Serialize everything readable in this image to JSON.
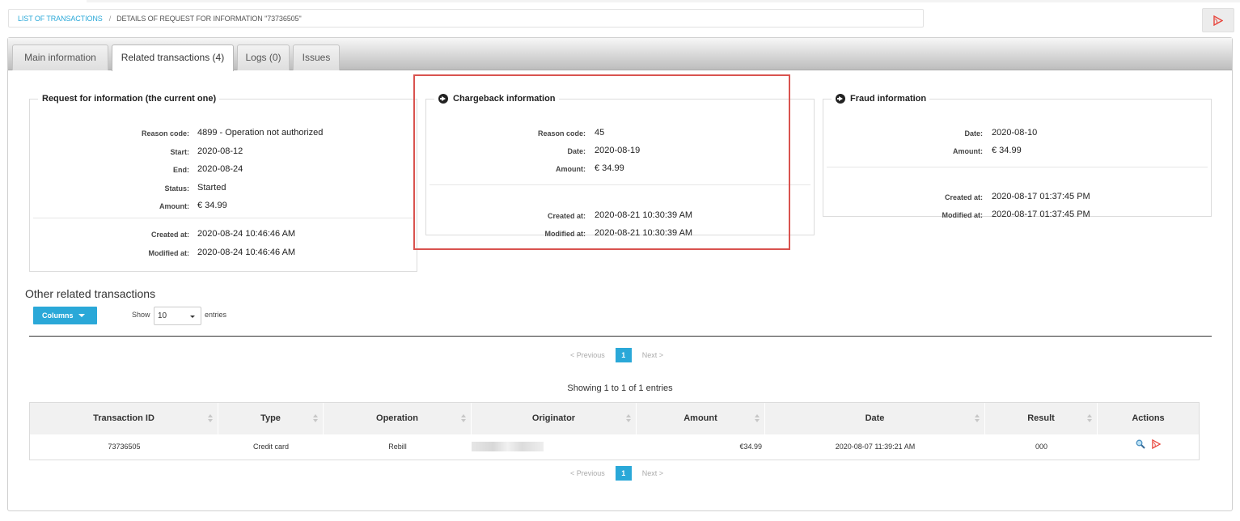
{
  "breadcrumb": {
    "link": "LIST OF TRANSACTIONS",
    "separator": "/",
    "current": "DETAILS OF REQUEST FOR INFORMATION \"73736505\""
  },
  "tabs": [
    {
      "label": "Main information",
      "active": false
    },
    {
      "label": "Related transactions (4)",
      "active": true
    },
    {
      "label": "Logs (0)",
      "active": false
    },
    {
      "label": "Issues",
      "active": false
    }
  ],
  "rfi": {
    "title": "Request for information (the current one)",
    "rows": [
      {
        "label": "Reason code:",
        "value": "4899 - Operation not authorized"
      },
      {
        "label": "Start:",
        "value": "2020-08-12"
      },
      {
        "label": "End:",
        "value": "2020-08-24"
      },
      {
        "label": "Status:",
        "value": "Started"
      },
      {
        "label": "Amount:",
        "value": "€ 34.99"
      }
    ],
    "meta": [
      {
        "label": "Created at:",
        "value": "2020-08-24 10:46:46 AM"
      },
      {
        "label": "Modified at:",
        "value": "2020-08-24 10:46:46 AM"
      }
    ]
  },
  "chargeback": {
    "title": "Chargeback information",
    "rows": [
      {
        "label": "Reason code:",
        "value": "45"
      },
      {
        "label": "Date:",
        "value": "2020-08-19"
      },
      {
        "label": "Amount:",
        "value": "€ 34.99"
      }
    ],
    "meta": [
      {
        "label": "Created at:",
        "value": "2020-08-21 10:30:39 AM"
      },
      {
        "label": "Modified at:",
        "value": "2020-08-21 10:30:39 AM"
      }
    ]
  },
  "fraud": {
    "title": "Fraud information",
    "rows": [
      {
        "label": "Date:",
        "value": "2020-08-10"
      },
      {
        "label": "Amount:",
        "value": "€ 34.99"
      }
    ],
    "meta": [
      {
        "label": "Created at:",
        "value": "2020-08-17 01:37:45 PM"
      },
      {
        "label": "Modified at:",
        "value": "2020-08-17 01:37:45 PM"
      }
    ]
  },
  "related": {
    "title": "Other related transactions",
    "columns_button": "Columns",
    "show_label": "Show",
    "entries_value": "10",
    "entries_label": "entries",
    "pager": {
      "prev": "< Previous",
      "page": "1",
      "next": "Next >"
    },
    "showing": "Showing 1 to 1 of 1 entries",
    "headers": [
      "Transaction ID",
      "Type",
      "Operation",
      "Originator",
      "Amount",
      "Date",
      "Result",
      "Actions"
    ],
    "rows": [
      {
        "transaction_id": "73736505",
        "type": "Credit card",
        "operation": "Rebill",
        "originator": "",
        "amount": "€34.99",
        "date": "2020-08-07 11:39:21 AM",
        "result": "000"
      }
    ]
  },
  "colors": {
    "accent": "#2aa8d8",
    "highlight_border": "#d9534f",
    "pdf_red": "#e8453c"
  },
  "icons": {
    "pdf": "pdf-icon",
    "view": "magnifier-icon",
    "info": "arrow-circle-right-icon"
  }
}
